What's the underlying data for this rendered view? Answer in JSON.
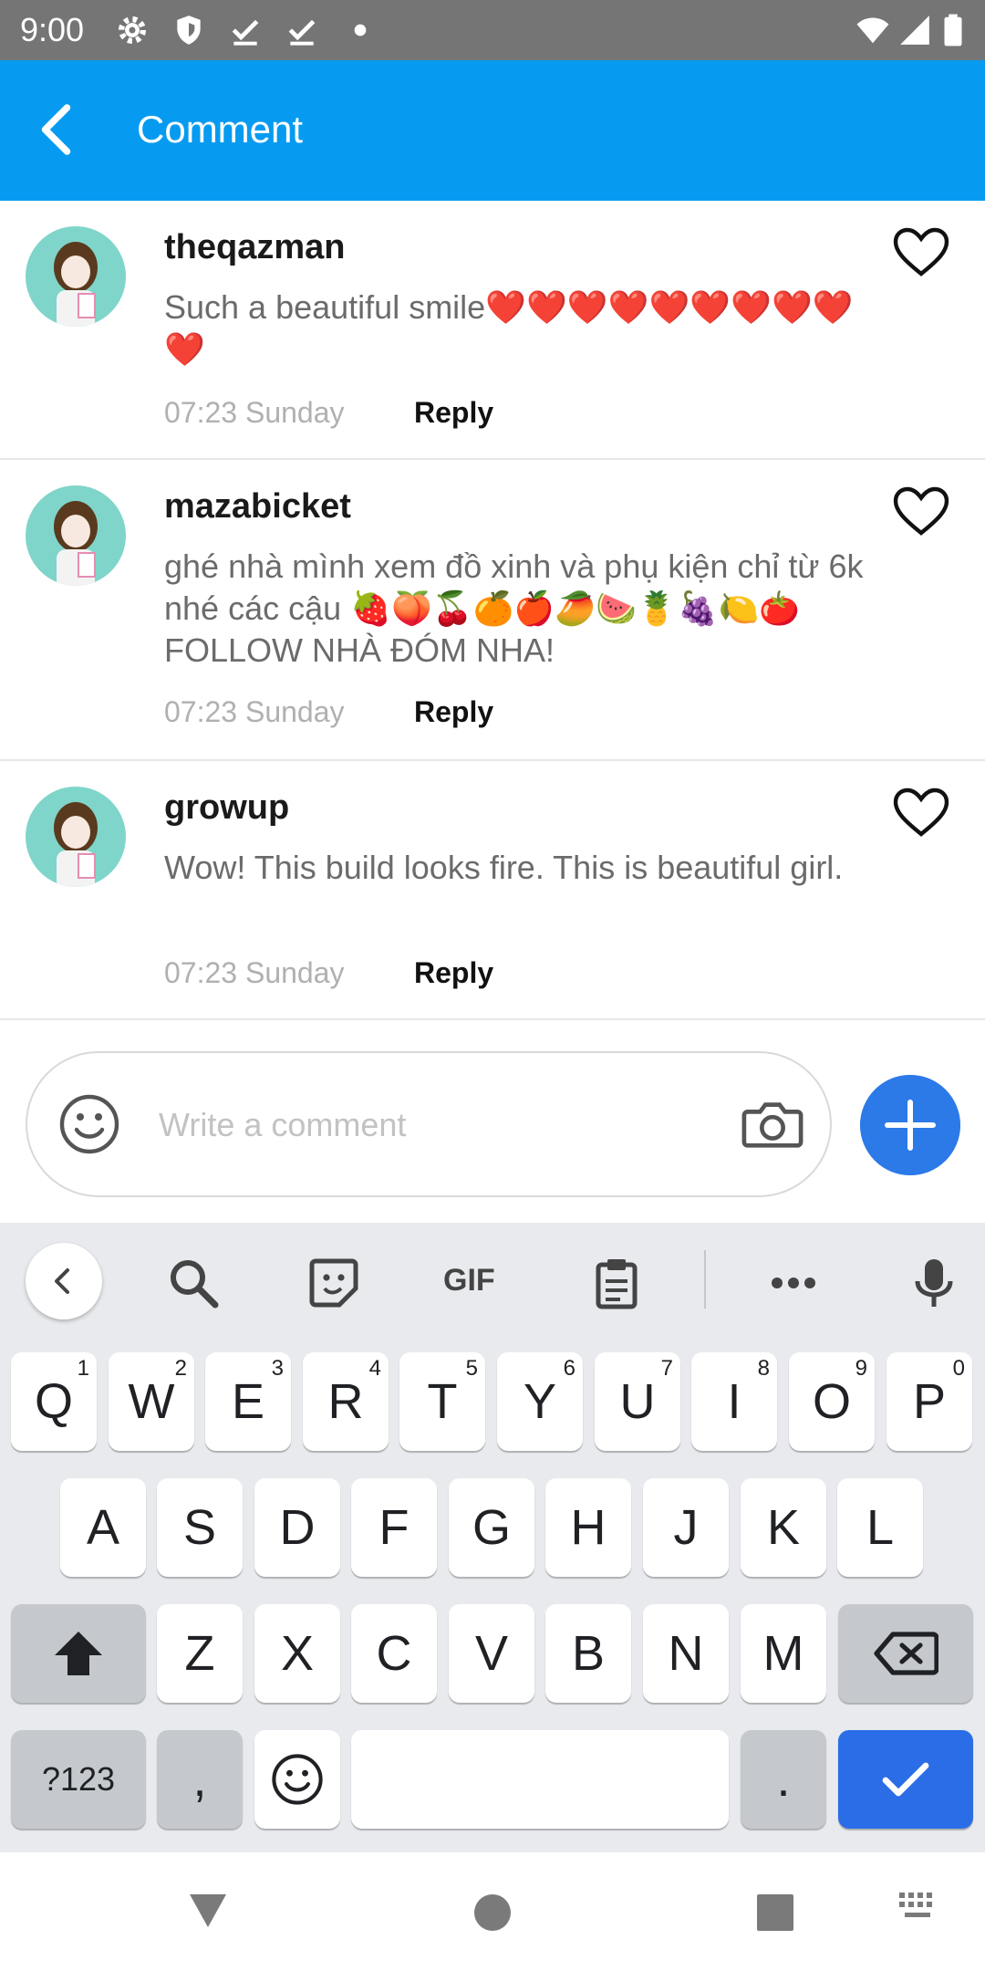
{
  "status_bar": {
    "time": "9:00"
  },
  "app_bar": {
    "title": "Comment"
  },
  "comments": [
    {
      "username": "theqazman",
      "text": "Such a beautiful smile❤️❤️❤️❤️❤️❤️❤️❤️❤️❤️",
      "time": "07:23 Sunday",
      "reply_label": "Reply"
    },
    {
      "username": "mazabicket",
      "text": "ghé nhà mình xem đồ xinh và phụ kiện chỉ từ 6k nhé các cậu 🍓🍑🍒🍊🍎🥭🍉🍍🍇🍋🍅 FOLLOW NHÀ ĐÓM NHA!",
      "time": "07:23 Sunday",
      "reply_label": "Reply"
    },
    {
      "username": "growup",
      "text": "Wow! This build looks fire. This is beautiful girl.",
      "time": "07:23 Sunday",
      "reply_label": "Reply"
    }
  ],
  "composer": {
    "placeholder": "Write a comment"
  },
  "keyboard": {
    "toolbar": {
      "gif_label": "GIF"
    },
    "row1": [
      {
        "label": "Q",
        "hint": "1"
      },
      {
        "label": "W",
        "hint": "2"
      },
      {
        "label": "E",
        "hint": "3"
      },
      {
        "label": "R",
        "hint": "4"
      },
      {
        "label": "T",
        "hint": "5"
      },
      {
        "label": "Y",
        "hint": "6"
      },
      {
        "label": "U",
        "hint": "7"
      },
      {
        "label": "I",
        "hint": "8"
      },
      {
        "label": "O",
        "hint": "9"
      },
      {
        "label": "P",
        "hint": "0"
      }
    ],
    "row2": [
      "A",
      "S",
      "D",
      "F",
      "G",
      "H",
      "J",
      "K",
      "L"
    ],
    "row3": [
      "Z",
      "X",
      "C",
      "V",
      "B",
      "N",
      "M"
    ],
    "bottom": {
      "symbols_label": "?123",
      "comma_label": ",",
      "period_label": "."
    }
  },
  "colors": {
    "app_bar": "#069BF0",
    "action_blue": "#2C79E8",
    "status_bar": "#757575"
  }
}
